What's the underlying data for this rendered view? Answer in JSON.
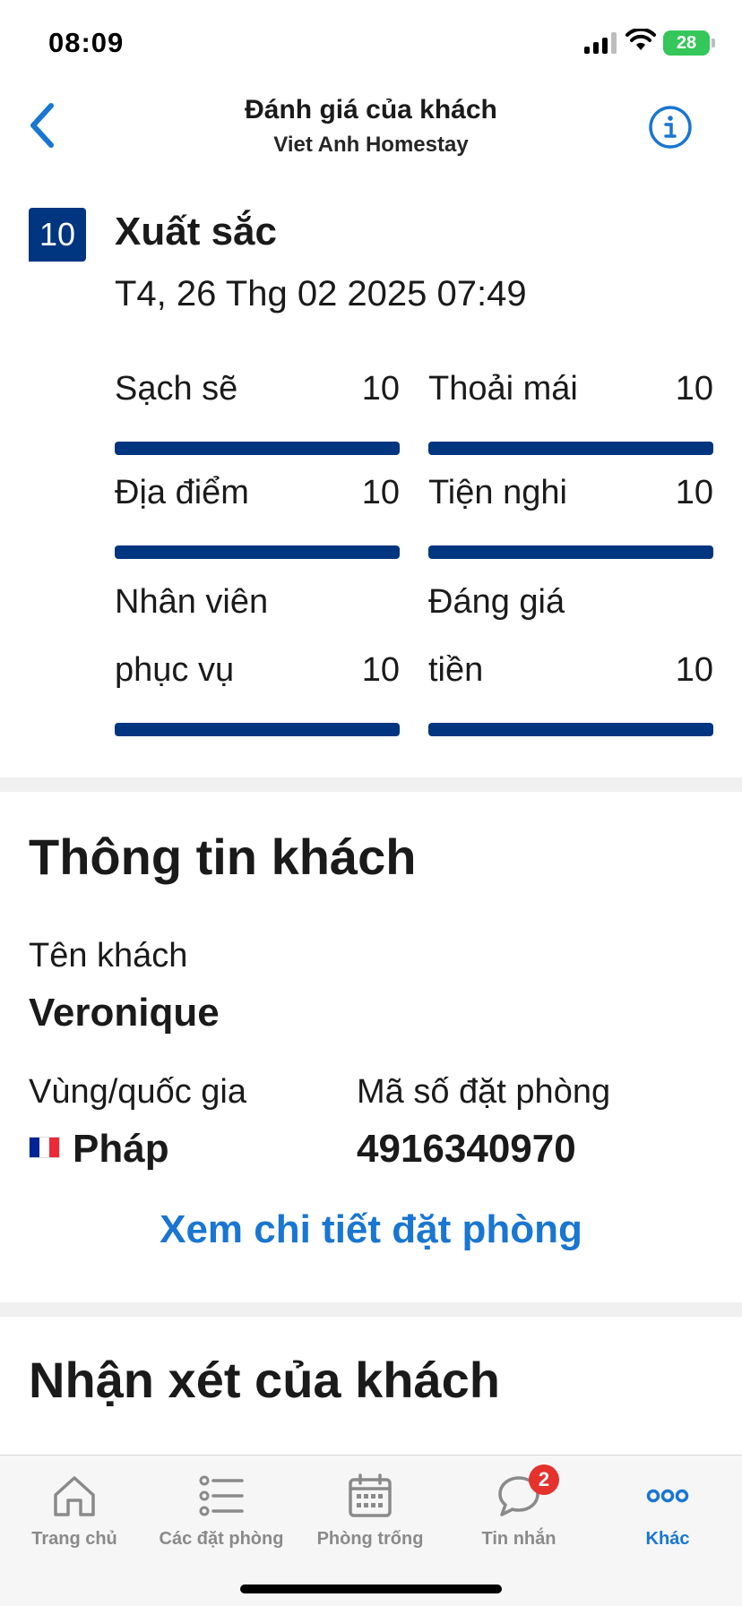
{
  "status_bar": {
    "time": "08:09",
    "battery": "28"
  },
  "header": {
    "title": "Đánh giá của khách",
    "subtitle": "Viet Anh Homestay"
  },
  "review": {
    "score": "10",
    "score_label": "Xuất sắc",
    "date": "T4, 26 Thg 02 2025 07:49",
    "categories": [
      {
        "name": "Sạch sẽ",
        "value": "10",
        "fill": 1.0
      },
      {
        "name": "Thoải mái",
        "value": "10",
        "fill": 1.0
      },
      {
        "name": "Địa điểm",
        "value": "10",
        "fill": 1.0
      },
      {
        "name": "Tiện nghi",
        "value": "10",
        "fill": 1.0
      },
      {
        "name": "Nhân viên phục vụ",
        "value": "10",
        "fill": 1.0
      },
      {
        "name": "Đáng giá tiền",
        "value": "10",
        "fill": 1.0
      }
    ]
  },
  "guest_info": {
    "title": "Thông tin khách",
    "name_label": "Tên khách",
    "name": "Veronique",
    "country_label": "Vùng/quốc gia",
    "country": "Pháp",
    "booking_label": "Mã số đặt phòng",
    "booking_number": "4916340970",
    "details_link": "Xem chi tiết đặt phòng"
  },
  "comments": {
    "title": "Nhận xét của khách"
  },
  "tab_bar": {
    "tabs": [
      {
        "label": "Trang chủ",
        "icon": "home-icon"
      },
      {
        "label": "Các đặt phòng",
        "icon": "list-icon"
      },
      {
        "label": "Phòng trống",
        "icon": "calendar-icon"
      },
      {
        "label": "Tin nhắn",
        "icon": "chat-icon",
        "badge": "2"
      },
      {
        "label": "Khác",
        "icon": "more-icon",
        "active": true
      }
    ]
  },
  "colors": {
    "brand_blue": "#003580",
    "link_blue": "#1976d2",
    "badge_red": "#e5322d",
    "flag_france": [
      "#002395",
      "#ffffff",
      "#ed2939"
    ]
  }
}
